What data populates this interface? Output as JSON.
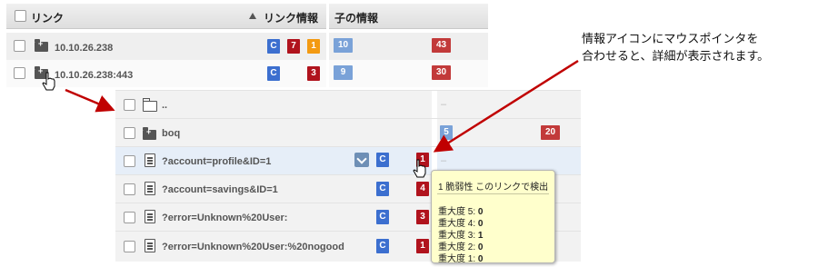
{
  "header": {
    "link_label": "リンク",
    "link_info_label": "リンク情報",
    "child_info_label": "子の情報"
  },
  "hosts": [
    {
      "name": "10.10.26.238",
      "badges": [
        "C",
        "7",
        "1"
      ],
      "child_badges": [
        "10",
        "43"
      ]
    },
    {
      "name": "10.10.26.238:443",
      "badges": [
        "C",
        "3"
      ],
      "child_badges": [
        "9",
        "30"
      ]
    }
  ],
  "children": [
    {
      "path": "..",
      "type": "folder-open"
    },
    {
      "path": "boq",
      "type": "folder",
      "child_badges": [
        "5",
        "20"
      ]
    },
    {
      "path": "?account=profile&ID=1",
      "type": "document",
      "badges": [
        "C",
        "1"
      ]
    },
    {
      "path": "?account=savings&ID=1",
      "type": "document",
      "badges": [
        "C",
        "4"
      ]
    },
    {
      "path": "?error=Unknown%20User:",
      "type": "document",
      "badges": [
        "C",
        "3"
      ]
    },
    {
      "path": "?error=Unknown%20User:%20nogood",
      "type": "document",
      "badges": [
        "C",
        "1"
      ]
    }
  ],
  "empty_marker": "–",
  "tooltip": {
    "header": "1 脆弱性  このリンクで検出",
    "severities": [
      {
        "label": "重大度 5: ",
        "value": "0"
      },
      {
        "label": "重大度 4: ",
        "value": "0"
      },
      {
        "label": "重大度 3: ",
        "value": "1"
      },
      {
        "label": "重大度 2: ",
        "value": "0"
      },
      {
        "label": "重大度 1: ",
        "value": "0"
      }
    ]
  },
  "annotation": {
    "line1": "情報アイコンにマウスポインタを",
    "line2": "合わせると、詳細が表示されます。"
  },
  "colors": {
    "c_badge": "#3c6fcf",
    "severity_red": "#b0131d",
    "severity_orange": "#f39a12",
    "child_blue": "#7aa2d8",
    "child_red": "#c23a3a",
    "tooltip_bg": "#ffffcc",
    "arrow": "#c00000"
  }
}
